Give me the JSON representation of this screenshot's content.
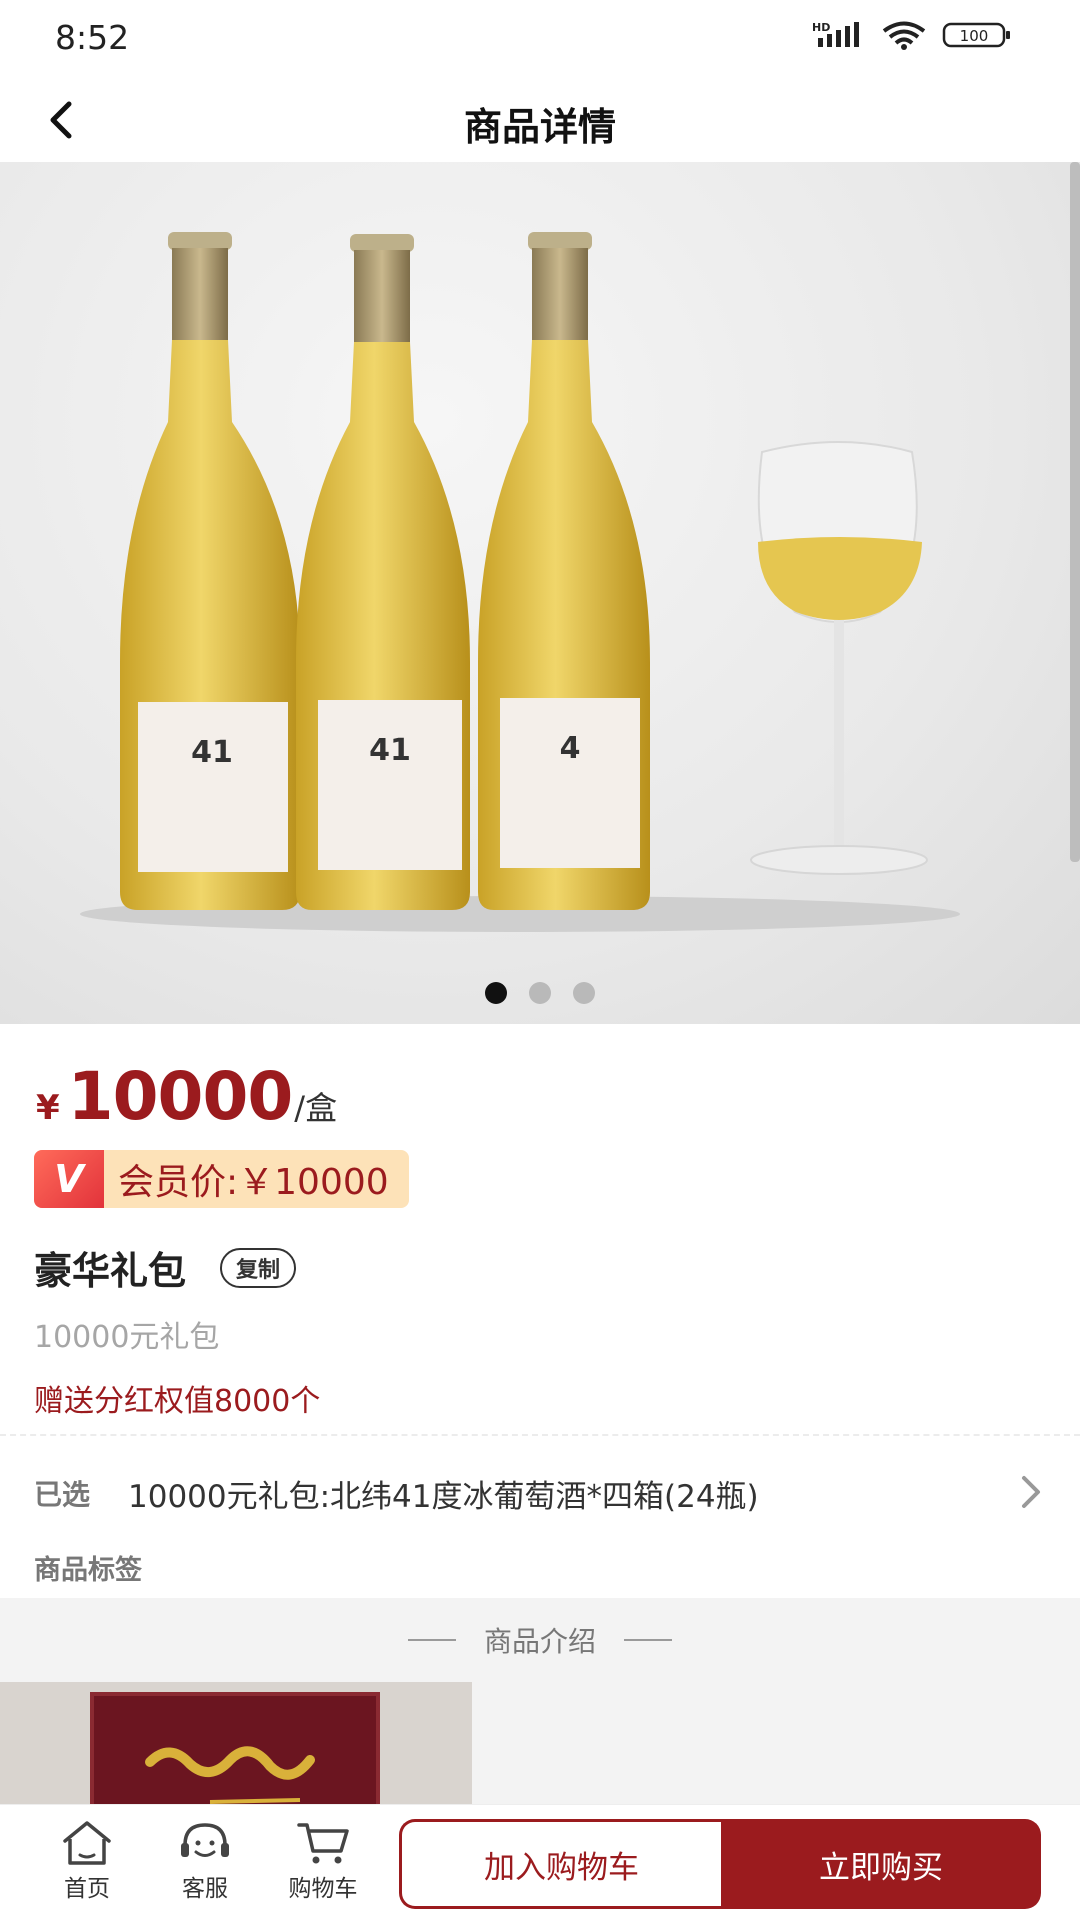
{
  "status_bar": {
    "time": "8:52",
    "network_label": "HD",
    "battery": "100"
  },
  "nav": {
    "title": "商品详情",
    "back_icon": "chevron-left-icon"
  },
  "gallery": {
    "image": "ice-wine-bottles-and-glass",
    "slide_count": 3,
    "active_slide": 1
  },
  "price": {
    "symbol": "¥",
    "value": "10000",
    "unit": "/盒"
  },
  "member": {
    "badge": "V",
    "text": "会员价:￥10000"
  },
  "product": {
    "title": "豪华礼包",
    "copy_label": "复制",
    "subtitle": "10000元礼包",
    "bonus": "赠送分红权值8000个"
  },
  "selection": {
    "label": "已选",
    "value": "10000元礼包:北纬41度冰葡萄酒*四箱(24瓶)"
  },
  "tags": {
    "label": "商品标签"
  },
  "intro": {
    "heading": "商品介绍"
  },
  "tab_bar": {
    "home": "首页",
    "service": "客服",
    "cart": "购物车",
    "add_to_cart": "加入购物车",
    "buy_now": "立即购买"
  },
  "colors": {
    "accent": "#9b1b1e",
    "member_bg": "#fde2b8"
  }
}
